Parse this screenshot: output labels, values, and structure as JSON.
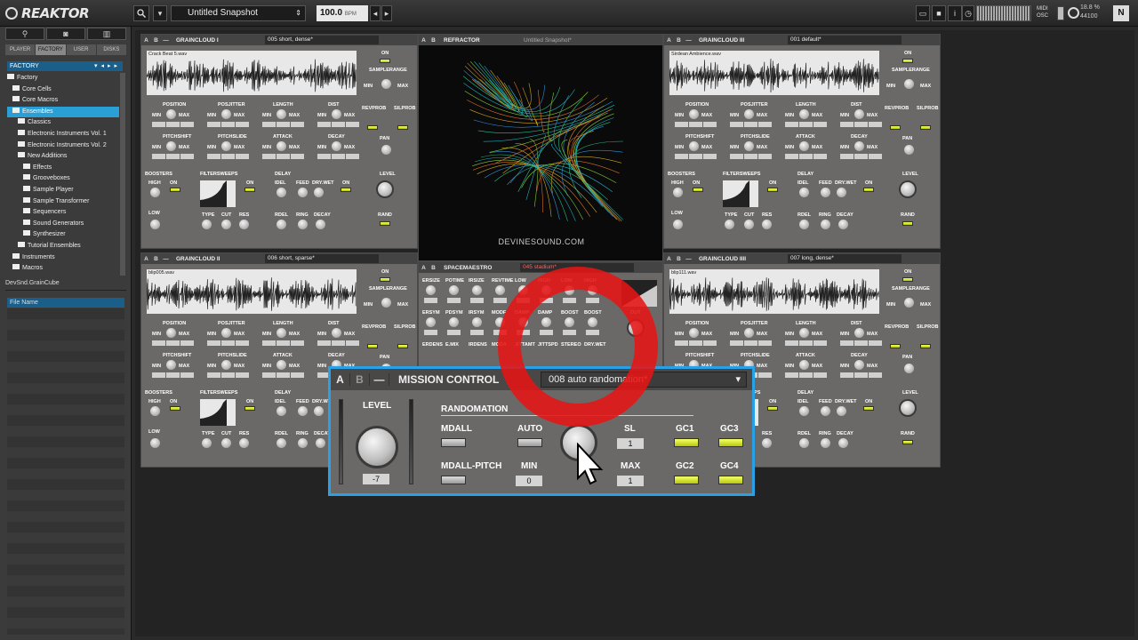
{
  "app": {
    "name": "REAKTOR",
    "snapshot": "Untitled Snapshot",
    "bpm_value": "100.0",
    "bpm_unit": "BPM",
    "cpu": "18.8 %",
    "sample_rate": "44100",
    "ni_badge": "N",
    "midi_label": "MIDI",
    "osc_label": "OSC"
  },
  "sidebar": {
    "tabs": [
      "PLAYER",
      "FACTORY",
      "USER",
      "DISKS"
    ],
    "active_tab": "FACTORY",
    "location": "FACTORY",
    "tree": [
      {
        "label": "Factory",
        "indent": 0
      },
      {
        "label": "Core Cells",
        "indent": 1
      },
      {
        "label": "Core Macros",
        "indent": 1
      },
      {
        "label": "Ensembles",
        "indent": 1,
        "selected": true
      },
      {
        "label": "Classics",
        "indent": 2
      },
      {
        "label": "Electronic Instruments Vol. 1",
        "indent": 2
      },
      {
        "label": "Electronic Instruments Vol. 2",
        "indent": 2
      },
      {
        "label": "New Additions",
        "indent": 2
      },
      {
        "label": "Effects",
        "indent": 3
      },
      {
        "label": "Grooveboxes",
        "indent": 3
      },
      {
        "label": "Sample Player",
        "indent": 3
      },
      {
        "label": "Sample Transformer",
        "indent": 3
      },
      {
        "label": "Sequencers",
        "indent": 3
      },
      {
        "label": "Sound Generators",
        "indent": 3
      },
      {
        "label": "Synthesizer",
        "indent": 3
      },
      {
        "label": "Tutorial Ensembles",
        "indent": 2
      },
      {
        "label": "Instruments",
        "indent": 1
      },
      {
        "label": "Macros",
        "indent": 1
      }
    ],
    "selected_file": "DevSnd.GrainCube",
    "file_header": "File Name"
  },
  "panels": {
    "gc1": {
      "title": "GRAINCLOUD I",
      "preset": "005  short, dense*",
      "file": "Crack Beat 5.wav"
    },
    "gc2": {
      "title": "GRAINCLOUD II",
      "preset": "006  short, sparse*",
      "file": "blip005.wav"
    },
    "gc3": {
      "title": "GRAINCLOUD III",
      "preset": "001  default*",
      "file": "Sirdean Ambience.wav"
    },
    "gc4": {
      "title": "GRAINCLOUD IIII",
      "preset": "007  long, dense*",
      "file": "blip111.wav"
    },
    "refractor": {
      "title": "REFRACTOR",
      "preset": "Untitled Snapshot*",
      "credit": "DEVINESOUND.COM"
    },
    "spacemaestro": {
      "title": "SPACEMAESTRO",
      "preset": "045  stadium*"
    }
  },
  "grain_labels": {
    "on": "ON",
    "samplerange": "SAMPLERANGE",
    "min": "MIN",
    "max": "MAX",
    "revprob": "REVPROB",
    "slprob": "SILPROB",
    "position": "POSITION",
    "posjitter": "POSJITTER",
    "length": "LENGTH",
    "dist": "DIST",
    "pitchshift": "PITCHSHIFT",
    "pitchslide": "PITCHSLIDE",
    "attack": "ATTACK",
    "decay": "DECAY",
    "pan": "PAN",
    "boosters": "BOOSTERS",
    "filtersweeps": "FILTERSWEEPS",
    "delay": "DELAY",
    "level": "LEVEL",
    "high": "HIGH",
    "low": "LOW",
    "type": "TYPE",
    "cut": "CUT",
    "res": "RES",
    "idel": "IDEL",
    "feed": "FEED",
    "drywet": "DRY.WET",
    "rdel": "RDEL",
    "ring": "RING",
    "decay2": "DECAY",
    "rand": "RAND"
  },
  "space_labels": [
    "ERSIZE",
    "POTIME",
    "IRSIZE",
    "REVTIME",
    "LOW",
    "HIGH",
    "LOW",
    "HIGH",
    "ERSYM",
    "PDSYM",
    "IRSYM",
    "MODF",
    "DAMP",
    "DAMP",
    "BOOST",
    "BOOST",
    "ERDENS",
    "E.MIX",
    "IRDENS",
    "MODA",
    "JITTAMT",
    "JITTSPD",
    "STEREO",
    "DRY.WET"
  ],
  "space_out": "OUT",
  "mission_control": {
    "title": "MISSION CONTROL",
    "preset": "008  auto randomation*",
    "level_label": "LEVEL",
    "level_value": "-7",
    "section": "RANDOMATION",
    "mdall": "MDALL",
    "auto": "AUTO",
    "sl": "SL",
    "sl_value": "1",
    "mdall_pitch": "MDALL-PITCH",
    "min_label": "MIN",
    "min_value": "0",
    "max_label": "MAX",
    "max_value": "1",
    "gc1": "GC1",
    "gc2": "GC2",
    "gc3": "GC3",
    "gc4": "GC4",
    "a": "A",
    "b": "B",
    "minus": "—"
  },
  "colors": {
    "accent": "#2aa0e6",
    "led": "#e2f23c",
    "highlight_ring": "#e61414"
  }
}
